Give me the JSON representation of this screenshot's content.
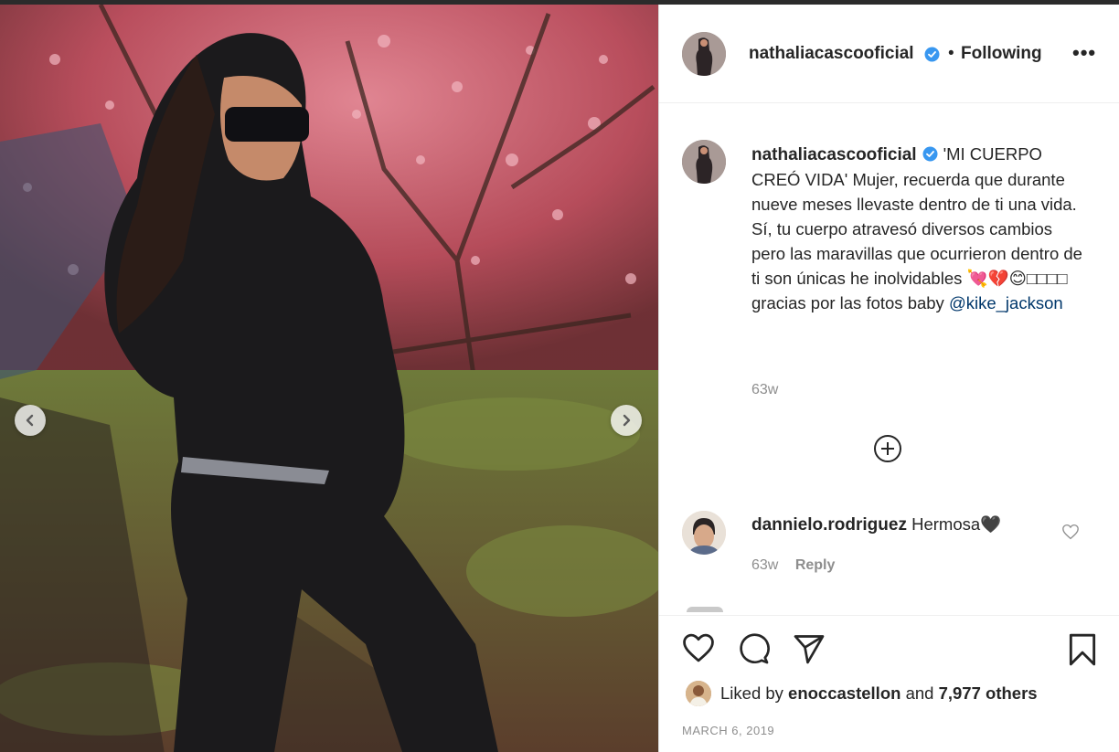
{
  "post": {
    "author": "nathaliacascooficial",
    "follow_separator": "•",
    "follow_status": "Following",
    "more_label": "•••"
  },
  "caption": {
    "author": "nathaliacascooficial",
    "text": "'MI CUERPO CREÓ VIDA' Mujer, recuerda que durante nueve meses llevaste dentro de ti una vida. Sí, tu cuerpo atravesó diversos cambios pero las maravillas que ocurrieron dentro de ti son únicas he inolvidables 💘💔😊□□□□ gracias por las fotos baby",
    "mention": "@kike_jackson",
    "age": "63w"
  },
  "comments": [
    {
      "author": "dannielo.rodriguez",
      "text": "Hermosa🖤",
      "age": "63w",
      "reply_label": "Reply"
    }
  ],
  "likes": {
    "prefix": "Liked by",
    "user": "enoccastellon",
    "and": "and",
    "others": "7,977 others"
  },
  "date": "MARCH 6, 2019",
  "icons": {
    "verified": "verified-badge-icon",
    "like": "heart-icon",
    "comment": "speech-bubble-icon",
    "share": "paper-plane-icon",
    "save": "bookmark-icon",
    "load_more": "plus-circle-icon",
    "prev": "chevron-left-icon",
    "next": "chevron-right-icon"
  },
  "colors": {
    "verified": "#3897f0",
    "link": "#00376b",
    "muted": "#8e8e8e"
  }
}
